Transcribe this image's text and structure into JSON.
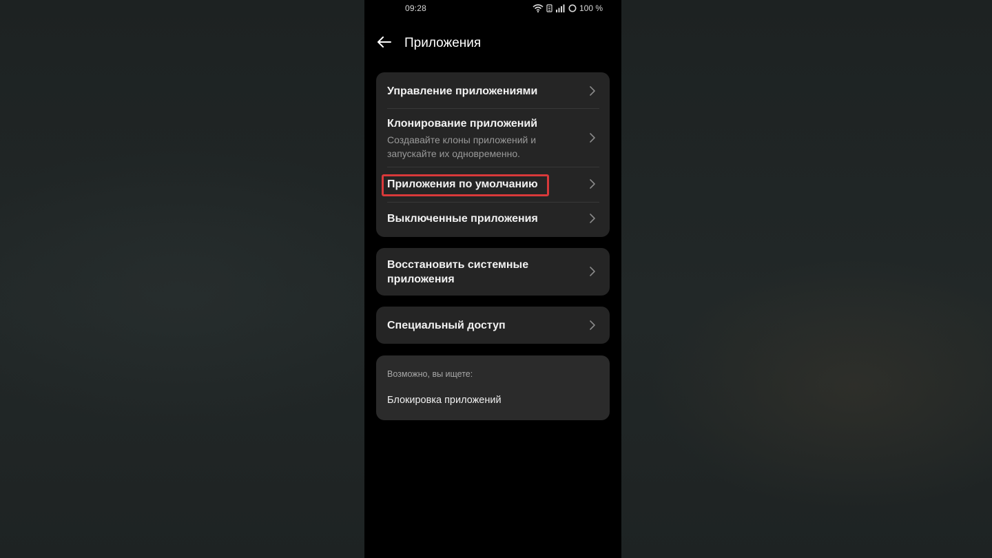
{
  "status_bar": {
    "time": "09:28",
    "battery": "100 %",
    "icons": [
      "wifi-icon",
      "sim-icon",
      "signal-icon",
      "battery-icon"
    ]
  },
  "header": {
    "back_icon": "arrow-left-icon",
    "title": "Приложения"
  },
  "group1": {
    "items": [
      {
        "title": "Управление приложениями",
        "subtitle": ""
      },
      {
        "title": "Клонирование приложений",
        "subtitle": "Создавайте клоны приложений и запускайте их одновременно."
      },
      {
        "title": "Приложения по умолчанию",
        "subtitle": "",
        "highlighted": true
      },
      {
        "title": "Выключенные приложения",
        "subtitle": ""
      }
    ]
  },
  "group2": {
    "items": [
      {
        "title": "Восстановить системные приложения"
      }
    ]
  },
  "group3": {
    "items": [
      {
        "title": "Специальный доступ"
      }
    ]
  },
  "suggestions": {
    "label": "Возможно, вы ищете:",
    "items": [
      "Блокировка приложений"
    ]
  },
  "colors": {
    "screen_bg": "#000000",
    "card_bg": "#252525",
    "highlight": "#d9393a",
    "text_primary": "#f2f2f2",
    "text_secondary": "#9a9a9a"
  }
}
